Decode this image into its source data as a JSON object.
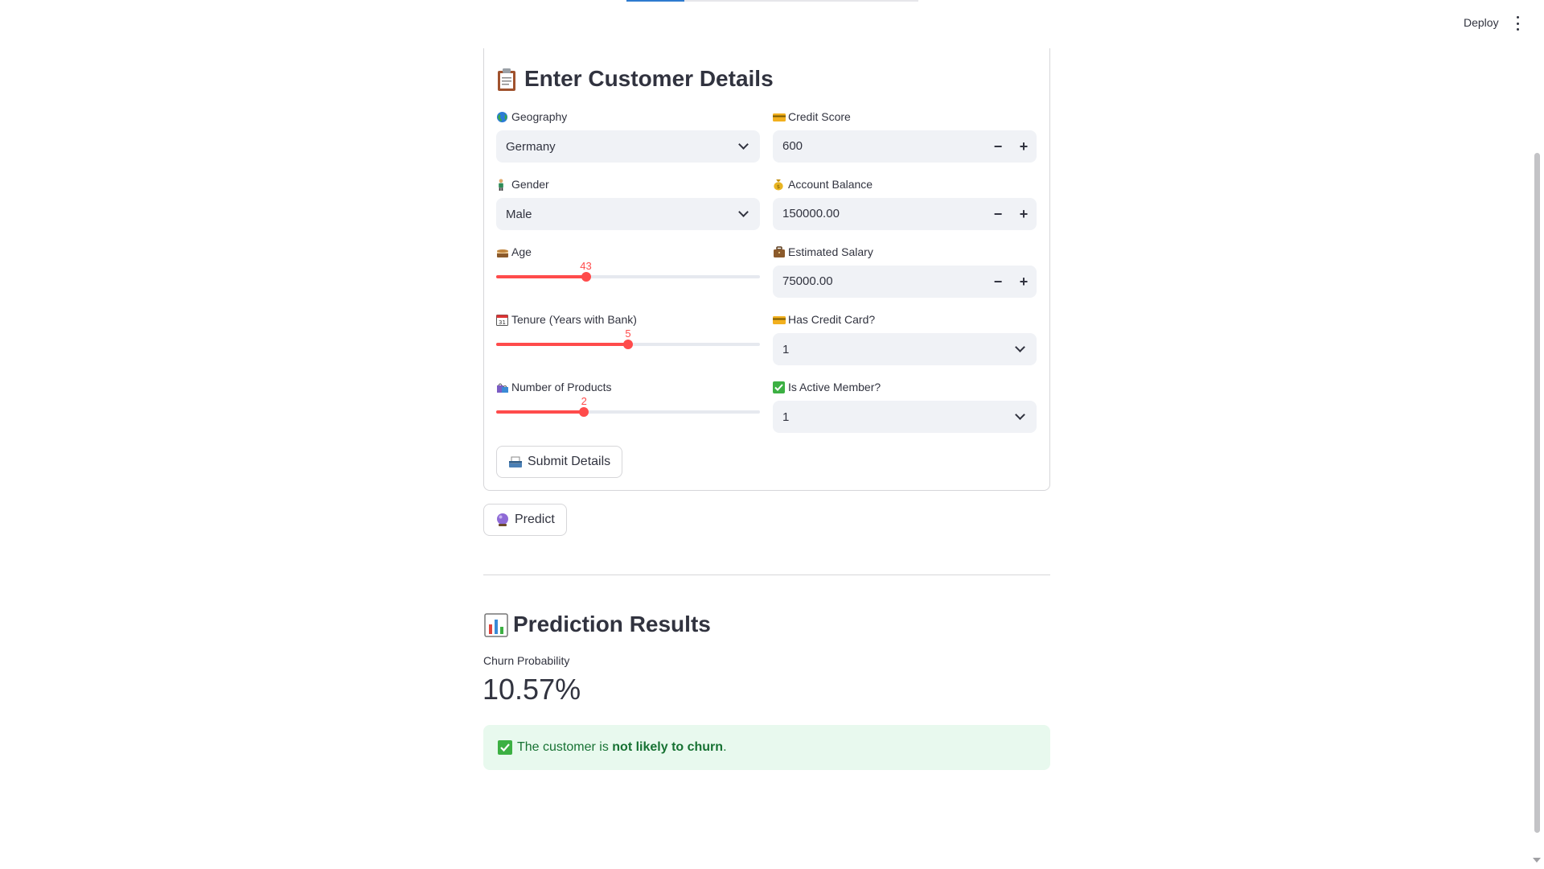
{
  "header": {
    "deploy_label": "Deploy"
  },
  "form": {
    "title": "Enter Customer Details",
    "geography": {
      "label": "Geography",
      "value": "Germany"
    },
    "credit_score": {
      "label": "Credit Score",
      "value": "600"
    },
    "gender": {
      "label": "Gender",
      "value": "Male"
    },
    "account_balance": {
      "label": "Account Balance",
      "value": "150000.00"
    },
    "age": {
      "label": "Age",
      "value": "43",
      "fraction": 0.34
    },
    "estimated_salary": {
      "label": "Estimated Salary",
      "value": "75000.00"
    },
    "tenure": {
      "label": "Tenure (Years with Bank)",
      "value": "5",
      "fraction": 0.5
    },
    "has_credit_card": {
      "label": "Has Credit Card?",
      "value": "1"
    },
    "num_products": {
      "label": "Number of Products",
      "value": "2",
      "fraction": 0.333
    },
    "is_active_member": {
      "label": "Is Active Member?",
      "value": "1"
    },
    "submit_label": "Submit Details"
  },
  "predict_label": "Predict",
  "results": {
    "title": "Prediction Results",
    "metric_label": "Churn Probability",
    "metric_value": "10.57%",
    "alert_prefix": "The customer is ",
    "alert_bold": "not likely to churn",
    "alert_suffix": "."
  },
  "colors": {
    "accent": "#ff4b4b",
    "success_bg": "#e8f9ee",
    "success_text": "#177233",
    "input_bg": "#f0f2f6"
  }
}
